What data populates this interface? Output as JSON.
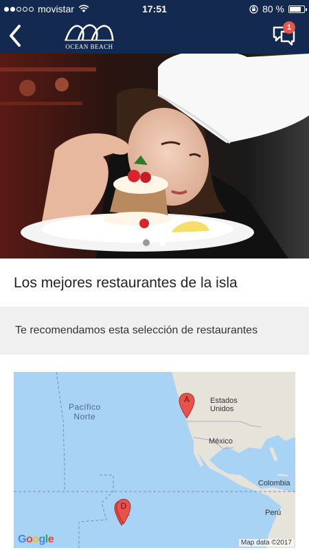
{
  "status_bar": {
    "carrier": "movistar",
    "time": "17:51",
    "battery_percent": "80 %",
    "battery_level": 0.8
  },
  "nav": {
    "logo_text": "OCEAN BEACH",
    "chat_badge_count": "1"
  },
  "hero": {
    "image": "chef-plating-dessert",
    "carousel_total": 2,
    "carousel_active": 2
  },
  "content": {
    "title": "Los mejores restaurantes de la isla",
    "subtitle": "Te recomendamos esta selección de restaurantes"
  },
  "map": {
    "labels": {
      "ocean": "Pacífico\nNorte",
      "usa": "Estados\nUnidos",
      "mexico": "México",
      "colombia": "Colombia",
      "peru": "Perú"
    },
    "markers": [
      {
        "letter": "A"
      },
      {
        "letter": "D"
      }
    ],
    "attribution": "Map data ©2017",
    "provider": "Google"
  },
  "colors": {
    "nav_bg": "#13294f",
    "badge": "#e8564a",
    "ocean": "#a8d3f5",
    "land": "#e6e3db",
    "marker": "#e8524a"
  }
}
